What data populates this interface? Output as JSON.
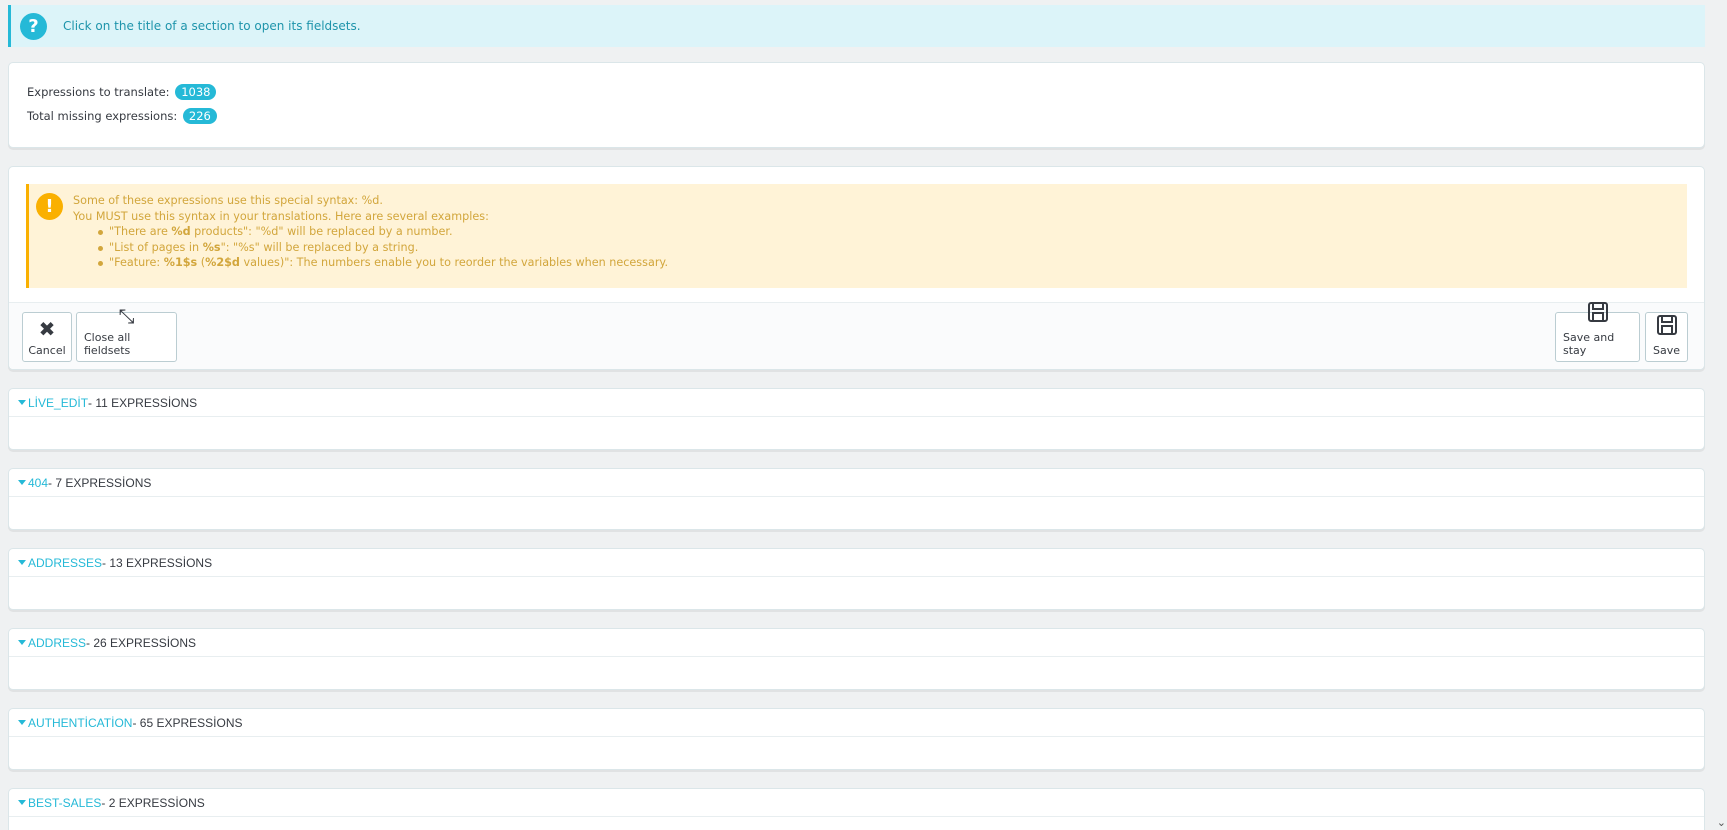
{
  "info": {
    "text": "Click on the title of a section to open its fieldsets."
  },
  "stats": {
    "expressions_label": "Expressions to translate:",
    "expressions_count": "1038",
    "missing_label": "Total missing expressions:",
    "missing_count": "226"
  },
  "warning": {
    "line1": "Some of these expressions use this special syntax: %d.",
    "line2": "You MUST use this syntax in your translations. Here are several examples:",
    "ex1": {
      "a": "\"There are ",
      "b": "%d",
      "c": " products\": \"%d\" will be replaced by a number."
    },
    "ex2": {
      "a": "\"List of pages in ",
      "b": "%s",
      "c": "\": \"%s\" will be replaced by a string."
    },
    "ex3": {
      "a": "\"Feature: ",
      "b": "%1$s",
      "c": " (",
      "d": "%2$d",
      "e": " values)\": The numbers enable you to reorder the variables when necessary."
    }
  },
  "buttons": {
    "cancel": "Cancel",
    "close_all": "Close all fieldsets",
    "save_and_stay": "Save and stay",
    "save": "Save"
  },
  "sections": [
    {
      "title": "LİVE_EDİT",
      "count": " - 11 EXPRESSİONS"
    },
    {
      "title": "404",
      "count": " - 7 EXPRESSİONS"
    },
    {
      "title": "ADDRESSES",
      "count": " - 13 EXPRESSİONS"
    },
    {
      "title": "ADDRESS",
      "count": " - 26 EXPRESSİONS"
    },
    {
      "title": "AUTHENTİCATİON",
      "count": " - 65 EXPRESSİONS"
    },
    {
      "title": "BEST-SALES",
      "count": " - 2 EXPRESSİONS"
    }
  ],
  "colors": {
    "accent": "#25b9d7",
    "warning": "#fab000",
    "warning_text": "#d2a63c"
  },
  "icons": {
    "info": "question-circle-icon",
    "warning": "exclamation-circle-icon",
    "cancel": "close-icon",
    "close_all": "compress-icon",
    "save": "floppy-disk-icon"
  }
}
